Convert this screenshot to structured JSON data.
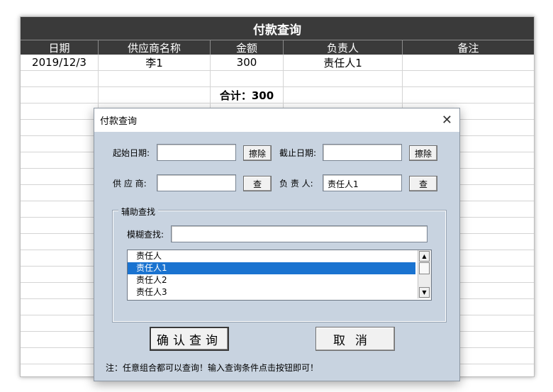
{
  "sheet": {
    "title": "付款查询",
    "headers": [
      "日期",
      "供应商名称",
      "金额",
      "负责人",
      "备注"
    ],
    "row1": [
      "2019/12/3",
      "李1",
      "300",
      "责任人1",
      ""
    ],
    "total": "合计：300"
  },
  "dialog": {
    "title": "付款查询",
    "close_glyph": "✕",
    "start_date_label": "起始日期:",
    "start_date_value": "",
    "clear_start_label": "擦除",
    "end_date_label": "截止日期:",
    "end_date_value": "",
    "clear_end_label": "擦除",
    "supplier_label": "供 应 商:",
    "supplier_value": "",
    "supplier_query_label": "查",
    "owner_label": "负 责 人:",
    "owner_value": "责任人1",
    "owner_query_label": "查",
    "aux_group_label": "辅助查找",
    "fuzzy_label": "模糊查找:",
    "fuzzy_value": "",
    "list_items": [
      "责任人",
      "责任人1",
      "责任人2",
      "责任人3"
    ],
    "selected_index": 1,
    "confirm_label": "确认查询",
    "cancel_label": "取消",
    "note": "注：任意组合都可以查询！输入查询条件点击按钮即可！"
  },
  "icons": {
    "close": "close-icon",
    "scroll_up": "triangle-up-icon",
    "scroll_down": "triangle-down-icon"
  },
  "colors": {
    "header_bg": "#3a3a3a",
    "dialog_bg": "#c8d3e0",
    "selection": "#1a73d0"
  }
}
